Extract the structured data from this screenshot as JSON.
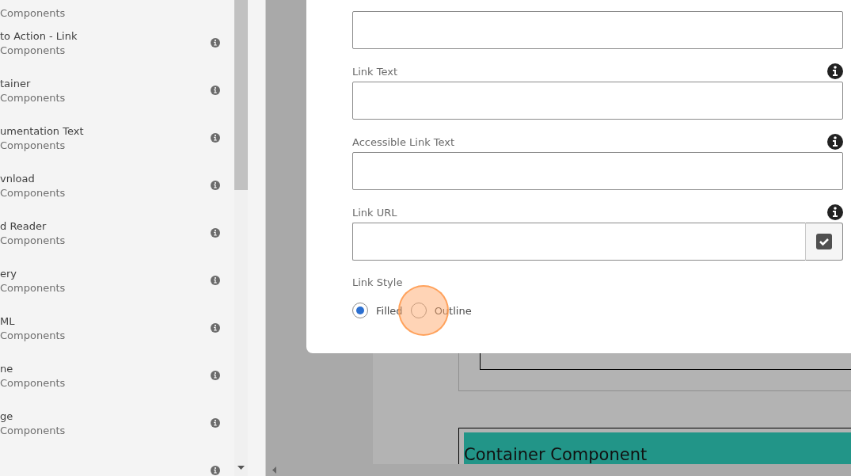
{
  "sidebar": {
    "items": [
      {
        "kind": "partial",
        "subtitle": "Components"
      },
      {
        "title": "to Action - Link",
        "subtitle": "Components"
      },
      {
        "title": "tainer",
        "subtitle": "Components"
      },
      {
        "title": "umentation Text",
        "subtitle": "Components"
      },
      {
        "title": "vnload",
        "subtitle": "Components"
      },
      {
        "title": "d Reader",
        "subtitle": "Components"
      },
      {
        "title": "ery",
        "subtitle": "Components"
      },
      {
        "title": "ML",
        "subtitle": "Components"
      },
      {
        "title": "ne",
        "subtitle": "Components"
      },
      {
        "title": "ge",
        "subtitle": "Components"
      },
      {
        "kind": "icon_only"
      }
    ]
  },
  "dialog": {
    "fields": [
      {
        "kind": "text"
      },
      {
        "kind": "text",
        "label": "Link Text"
      },
      {
        "kind": "text",
        "label": "Accessible Link Text"
      },
      {
        "kind": "url",
        "label": "Link URL"
      }
    ],
    "link_style": {
      "label": "Link Style",
      "options": [
        {
          "label": "Filled",
          "selected": true
        },
        {
          "label": "Outline",
          "selected": false
        }
      ]
    }
  },
  "page": {
    "container_title": "Container Component"
  }
}
